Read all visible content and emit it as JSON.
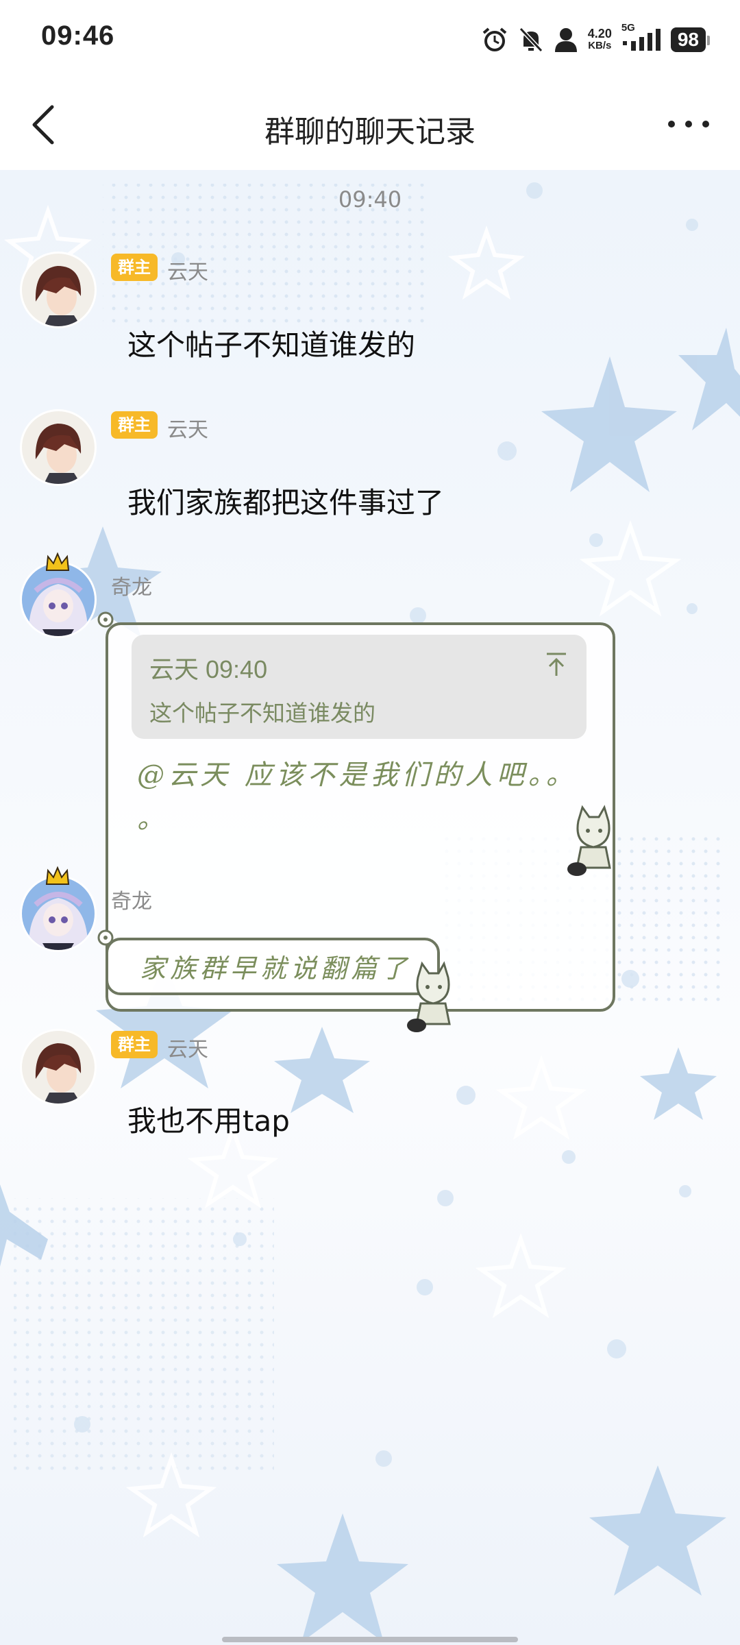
{
  "status_bar": {
    "time": "09:46",
    "net_speed_value": "4.20",
    "net_speed_unit": "KB/s",
    "network": "5G",
    "battery": "98"
  },
  "header": {
    "title": "群聊的聊天记录"
  },
  "chat": {
    "timestamp": "09:40",
    "messages": [
      {
        "sender": "云天",
        "badge": "群主",
        "text": "这个帖子不知道谁发的"
      },
      {
        "sender": "云天",
        "badge": "群主",
        "text": "我们家族都把这件事过了"
      },
      {
        "sender": "奇龙",
        "quote_head": "云天 09:40",
        "quote_text": "这个帖子不知道谁发的",
        "text_line1": "@云天 应该不是我们的人吧。。",
        "text_line2": "。"
      },
      {
        "sender": "奇龙",
        "text": "家族群早就说翻篇了"
      },
      {
        "sender": "云天",
        "badge": "群主",
        "text": "我也不用tap"
      }
    ]
  },
  "colors": {
    "badge": "#f7b928",
    "fancy_text": "#7b8e5c",
    "bubble_border": "#6e7760",
    "star": "#b9d1ea"
  }
}
